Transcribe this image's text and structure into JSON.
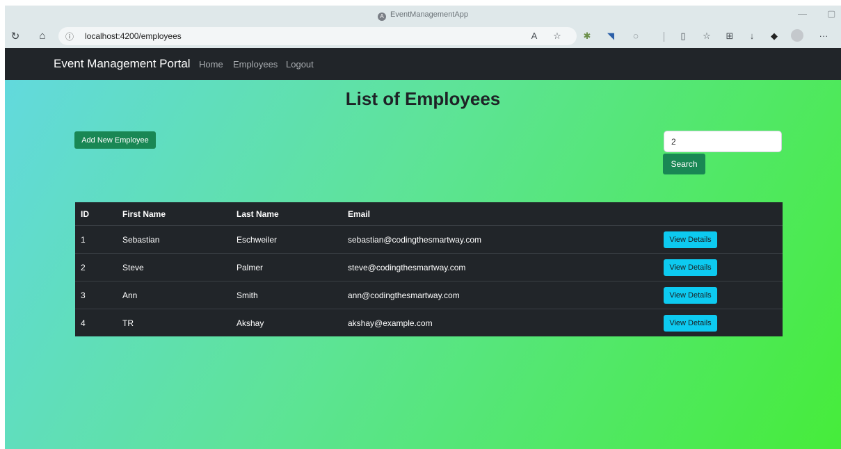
{
  "browser": {
    "window_title": "EventManagementApp",
    "url": "localhost:4200/employees",
    "icons": [
      "refresh-icon",
      "home-icon",
      "info-icon",
      "read-aloud-icon",
      "favorite-star-icon",
      "extension-icon",
      "extension-icon",
      "copilot-icon",
      "split-screen-icon",
      "favorites-icon",
      "collections-icon",
      "download-icon",
      "extension-icon",
      "profile-icon",
      "more-icon"
    ]
  },
  "navbar": {
    "brand": "Event Management Portal",
    "links": [
      "Home",
      "Employees",
      "Logout"
    ]
  },
  "page": {
    "title": "List of Employees",
    "add_button": "Add New Employee",
    "search_value": "2",
    "search_button": "Search"
  },
  "table": {
    "headers": [
      "ID",
      "First Name",
      "Last Name",
      "Email",
      ""
    ],
    "rows": [
      {
        "id": "1",
        "first": "Sebastian",
        "last": "Eschweiler",
        "email": "sebastian@codingthesmartway.com",
        "action": "View Details"
      },
      {
        "id": "2",
        "first": "Steve",
        "last": "Palmer",
        "email": "steve@codingthesmartway.com",
        "action": "View Details"
      },
      {
        "id": "3",
        "first": "Ann",
        "last": "Smith",
        "email": "ann@codingthesmartway.com",
        "action": "View Details"
      },
      {
        "id": "4",
        "first": "TR",
        "last": "Akshay",
        "email": "akshay@example.com",
        "action": "View Details"
      }
    ]
  },
  "colors": {
    "navbar_bg": "#212529",
    "primary_green": "#198754",
    "info_cyan": "#0dcaf0",
    "gradient_start": "#62d9dd",
    "gradient_end": "#46ec3a"
  }
}
